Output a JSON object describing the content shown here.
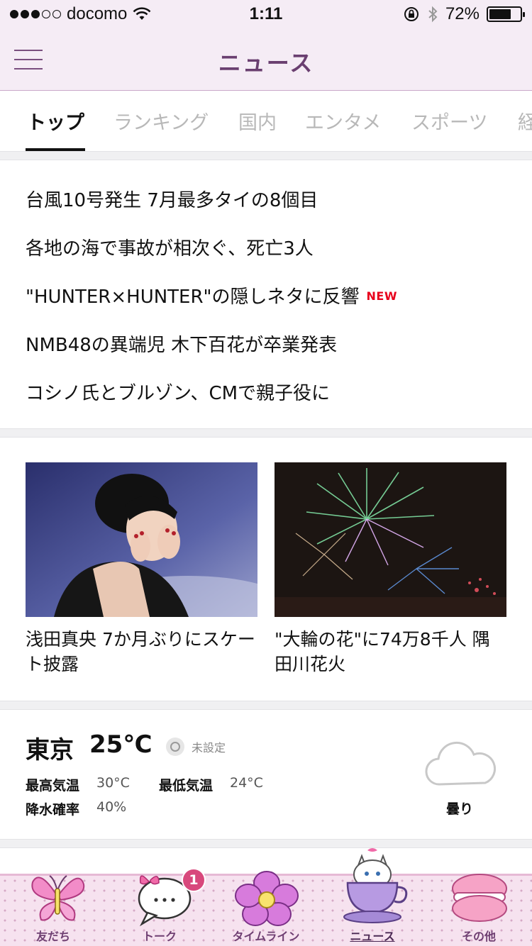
{
  "status_bar": {
    "carrier": "docomo",
    "time": "1:11",
    "battery": "72%",
    "battery_level": 0.72,
    "signal_bars": 3,
    "signal_total": 5
  },
  "nav": {
    "title": "ニュース"
  },
  "tabs": [
    {
      "label": "トップ",
      "active": true
    },
    {
      "label": "ランキング",
      "active": false
    },
    {
      "label": "国内",
      "active": false
    },
    {
      "label": "エンタメ",
      "active": false
    },
    {
      "label": "スポーツ",
      "active": false
    },
    {
      "label": "経",
      "active": false
    }
  ],
  "headlines": [
    {
      "text": "台風10号発生 7月最多タイの8個目"
    },
    {
      "text": "各地の海で事故が相次ぐ、死亡3人"
    },
    {
      "text": "\"HUNTER×HUNTER\"の隠しネタに反響",
      "badge": "NEW"
    },
    {
      "text": "NMB48の異端児 木下百花が卒業発表"
    },
    {
      "text": "コシノ氏とブルゾン、CMで親子役に"
    }
  ],
  "photo_cards": [
    {
      "caption": "浅田真央 7か月ぶりにスケート披露"
    },
    {
      "caption": "\"大輪の花\"に74万8千人 隅田川花火"
    }
  ],
  "weather": {
    "city": "東京",
    "temp": "25℃",
    "location_status": "未設定",
    "high_label": "最高気温",
    "high_value": "30°C",
    "low_label": "最低気温",
    "low_value": "24°C",
    "rain_label": "降水確率",
    "rain_value": "40%",
    "condition": "曇り",
    "condition_icon": "cloud-icon"
  },
  "tabbar": {
    "items": [
      {
        "label": "友だち",
        "icon": "butterfly-icon"
      },
      {
        "label": "トーク",
        "icon": "speech-bubble-icon",
        "badge": "1"
      },
      {
        "label": "タイムライン",
        "icon": "flower-icon"
      },
      {
        "label": "ニュース",
        "icon": "cat-teacup-icon",
        "active": true
      },
      {
        "label": "その他",
        "icon": "macaron-icon"
      }
    ]
  },
  "colors": {
    "header_bg": "#f5ecf5",
    "title": "#6a3f70",
    "new_badge": "#e8001c",
    "tab_badge": "#d8487c"
  }
}
